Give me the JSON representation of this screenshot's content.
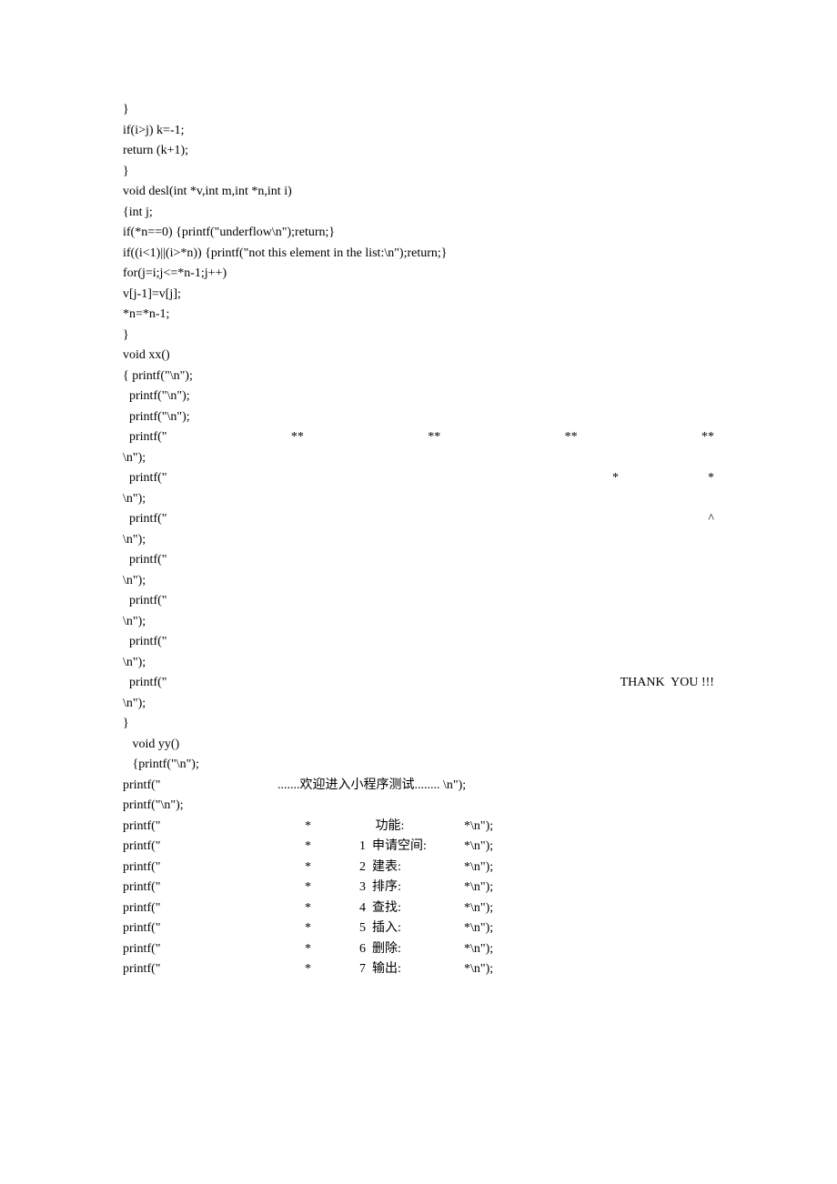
{
  "lines": [
    "}",
    "if(i>j) k=-1;",
    "return (k+1);",
    "}",
    "void desl(int *v,int m,int *n,int i)",
    "{int j;",
    "if(*n==0) {printf(\"underflow\\n\");return;}",
    "if((i<1)||(i>*n)) {printf(\"not this element in the list:\\n\");return;}",
    "for(j=i;j<=*n-1;j++)",
    "v[j-1]=v[j];",
    "*n=*n-1;",
    "}",
    "void xx()",
    "{ printf(\"\\n\");",
    "  printf(\"\\n\");",
    "  printf(\"\\n\");"
  ],
  "row_star4": {
    "left": "  printf(\"",
    "c1": "**",
    "c2": "**",
    "c3": "**",
    "c4": "**"
  },
  "n_line": "\\n\");",
  "row_star2": {
    "left": "  printf(\"",
    "c1": "*",
    "c2": "*"
  },
  "row_caret": {
    "left": "  printf(\"",
    "c1": "^"
  },
  "row_blank": "  printf(\"",
  "row_thank": {
    "left": "  printf(\"",
    "c1": "THANK",
    "c2": "YOU !!!"
  },
  "closebrace": "}",
  "yy1": "   void yy()",
  "yy2": "   {printf(\"\\n\");",
  "welcome": {
    "left": "printf(\"",
    "mid": ".......欢迎进入小程序测试........ \\n\");"
  },
  "pblank": "printf(\"\\n\");",
  "menu": [
    {
      "left": "printf(\"",
      "star": "*",
      "label": "     功能:",
      "end": "*\\n\");"
    },
    {
      "left": "printf(\"",
      "star": "*",
      "label": "1  申请空间:",
      "end": "*\\n\");"
    },
    {
      "left": "printf(\"",
      "star": "*",
      "label": "2  建表:",
      "end": "*\\n\");"
    },
    {
      "left": "printf(\"",
      "star": "*",
      "label": "3  排序:",
      "end": "*\\n\");"
    },
    {
      "left": "printf(\"",
      "star": "*",
      "label": "4  查找:",
      "end": "*\\n\");"
    },
    {
      "left": "printf(\"",
      "star": "*",
      "label": "5  插入:",
      "end": "*\\n\");"
    },
    {
      "left": "printf(\"",
      "star": "*",
      "label": "6  删除:",
      "end": "*\\n\");"
    },
    {
      "left": "printf(\"",
      "star": "*",
      "label": "7  输出:",
      "end": "*\\n\");"
    }
  ]
}
